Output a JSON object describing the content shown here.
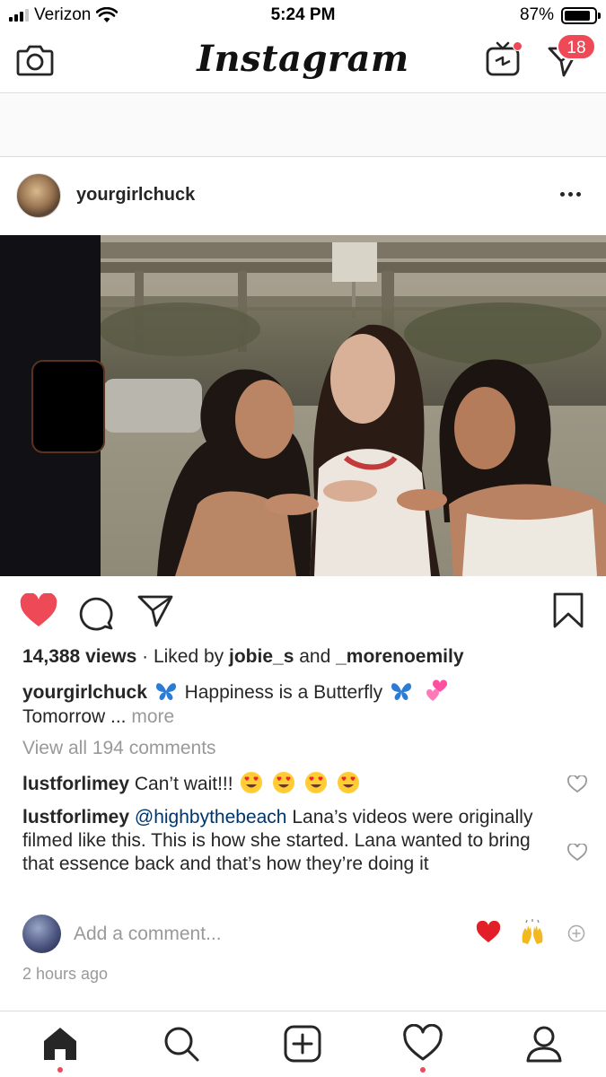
{
  "status_bar": {
    "carrier": "Verizon",
    "time": "5:24 PM",
    "battery": "87%",
    "battery_level": 0.87,
    "signal_bars": 3
  },
  "header": {
    "title": "Instagram",
    "dm_badge": "18",
    "icons": [
      "camera-icon",
      "igtv-icon",
      "direct-message-icon"
    ]
  },
  "post": {
    "username": "yourgirlchuck",
    "liked": true,
    "views": "14,388 views",
    "liked_by_prefix": "Liked by",
    "liked_by_1": "jobie_s",
    "liked_by_and": "and",
    "liked_by_2": "_morenoemily",
    "caption_user": "yourgirlchuck",
    "caption_text_1": "Happiness is a Butterfly",
    "caption_text_2": "Tomorrow ...",
    "caption_more": "more",
    "view_all_comments": "View all 194 comments",
    "comments": [
      {
        "user": "lustforlimey",
        "text": "Can’t wait!!!"
      },
      {
        "user": "lustforlimey",
        "mention": "@highbythebeach",
        "text": "Lana’s videos were originally filmed like this. This is how she started. Lana wanted to bring that essence back and that’s how they’re doing it"
      }
    ],
    "add_comment_placeholder": "Add a comment...",
    "time_ago": "2 hours ago"
  },
  "tab_bar": {
    "items": [
      "home-icon",
      "search-icon",
      "new-post-icon",
      "activity-icon",
      "profile-icon"
    ],
    "active": "home"
  },
  "colors": {
    "like_red": "#ed4956",
    "text": "#262626",
    "muted": "#999999",
    "mention": "#003569",
    "divider": "#dbdbdb"
  }
}
